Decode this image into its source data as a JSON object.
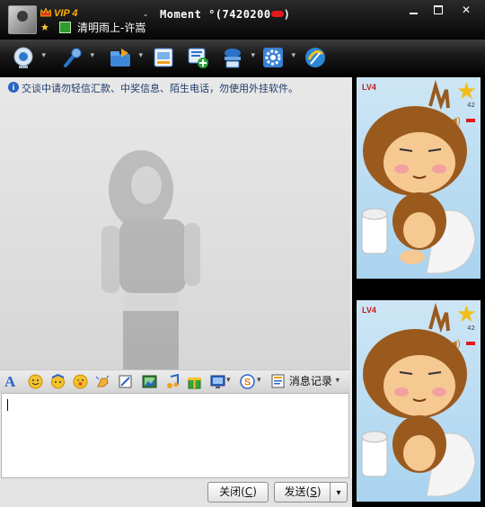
{
  "window": {
    "vip_label": "VIP 4",
    "signature": "清明雨上-许嵩",
    "title_dash": "-",
    "nickname": "Moment °(7420200",
    "nickname_suffix": ")",
    "minimize_label": "",
    "maximize_label": "",
    "close_label": "✕"
  },
  "toolbar": {
    "icons": [
      "video-icon",
      "microphone-icon",
      "file-transfer-icon",
      "sms-icon",
      "add-friend-icon",
      "remote-assist-icon",
      "settings-icon",
      "app-icon"
    ]
  },
  "chat": {
    "notice_icon": "i",
    "notice": "交谈中请勿轻信汇款、中奖信息、陌生电话，勿使用外挂软件。"
  },
  "format_bar": {
    "history_label": "消息记录"
  },
  "buttons": {
    "close_label": "关闭(",
    "close_key": "C",
    "close_tail": ")",
    "send_label": "发送(",
    "send_key": "S",
    "send_tail": ")"
  },
  "show_panel": {
    "level": "LV4",
    "level_count": "42"
  },
  "colors": {
    "accent": "#ffb000",
    "notice_text": "#1e3b6b",
    "panel_bg": "#a9d3ef"
  }
}
